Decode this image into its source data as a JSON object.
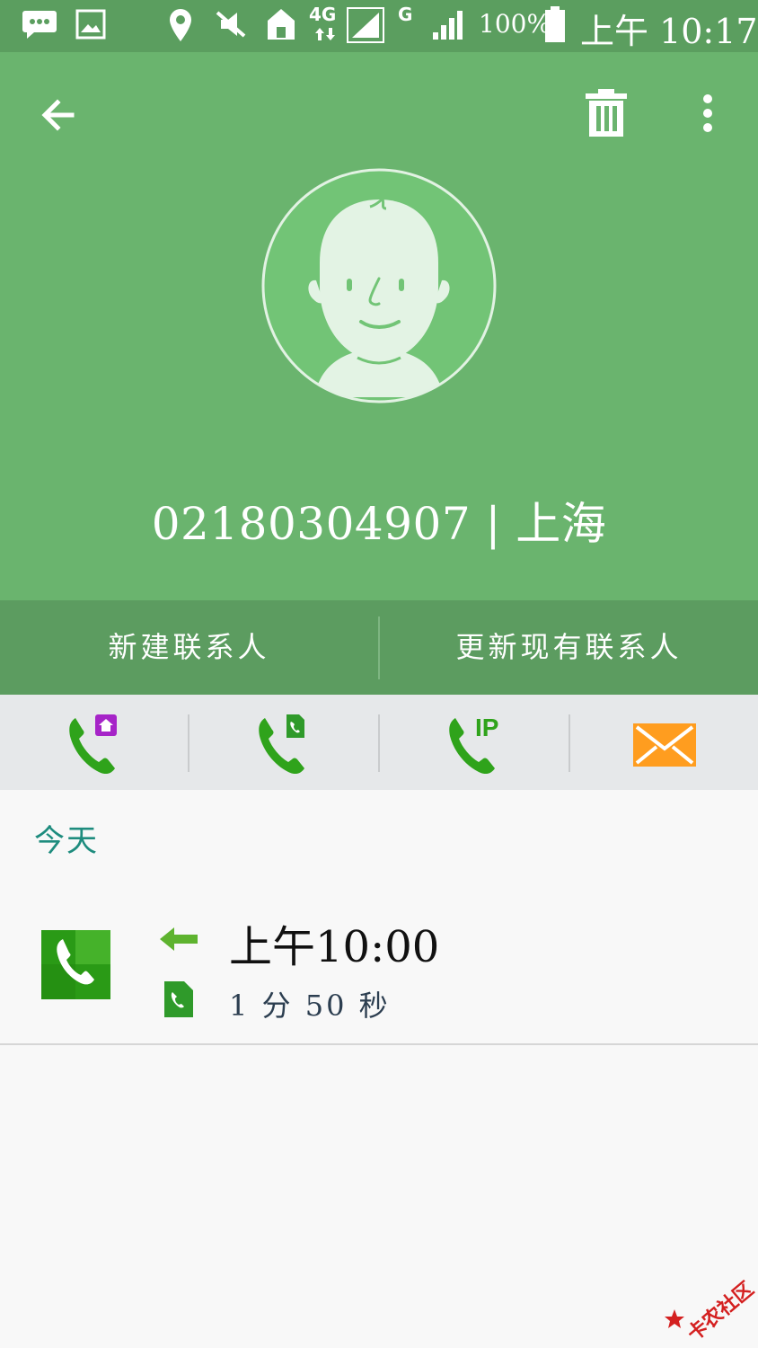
{
  "status_bar": {
    "battery": "100%",
    "time": "上午 10:17",
    "network_type": "4G",
    "network_type_2": "G",
    "icons": [
      "chat-icon",
      "image-icon",
      "location-icon",
      "mute-icon",
      "home-wifi-icon",
      "signal-icon",
      "battery-icon"
    ]
  },
  "header": {
    "caller": "02180304907 | 上海",
    "background_color": "#6ab46e",
    "icons": [
      "back-arrow-icon",
      "trash-icon",
      "more-vert-icon",
      "avatar-icon"
    ]
  },
  "contact_actions": {
    "new_contact": "新建联系人",
    "update_contact": "更新现有联系人"
  },
  "quick_actions": {
    "ip_label": "IP",
    "icons": [
      "call-home-icon",
      "call-sim-icon",
      "ip-call-icon",
      "message-icon"
    ]
  },
  "log": {
    "section": "今天",
    "entries": [
      {
        "time": "上午10:00",
        "duration": "1 分 50 秒",
        "direction": "incoming"
      }
    ]
  },
  "watermark": {
    "text": "卡农社区"
  },
  "colors": {
    "accent": "#1e8c7e",
    "call_green": "#2fa31b",
    "message_orange": "#ff9d1f"
  }
}
